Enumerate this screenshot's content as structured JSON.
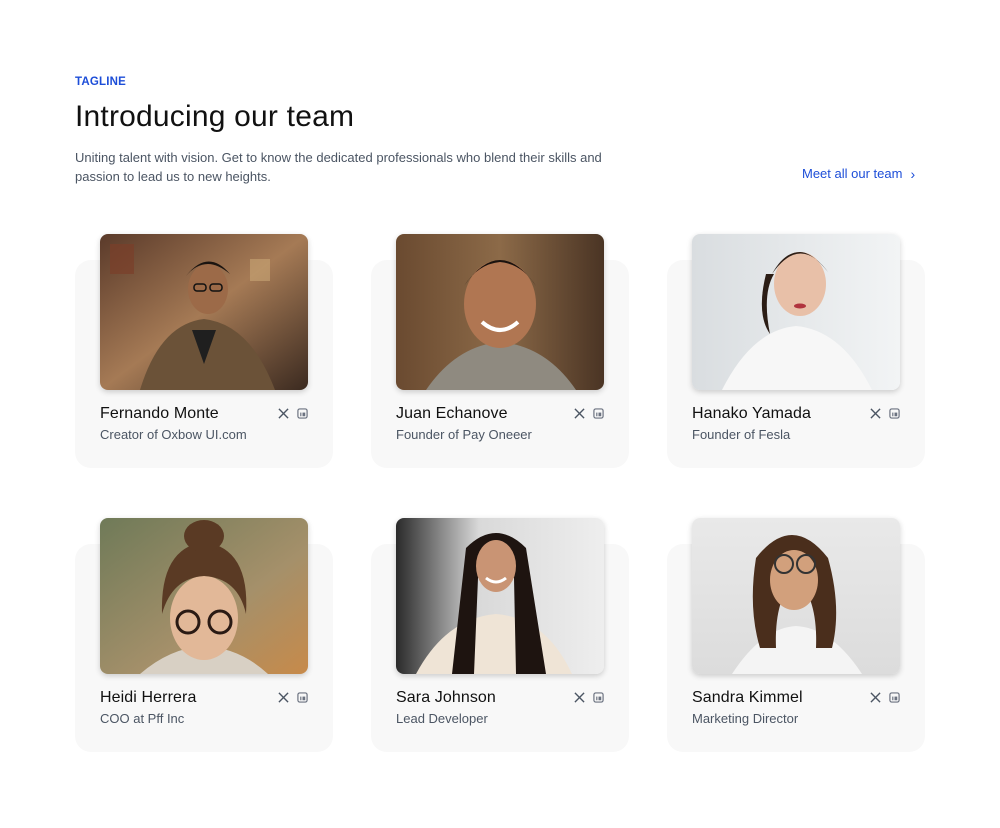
{
  "header": {
    "tagline": "TAGLINE",
    "title": "Introducing our team",
    "subtitle": "Uniting talent with vision. Get to know the dedicated professionals who blend their skills and passion to lead us to new heights.",
    "meet_link_label": "Meet all our team"
  },
  "colors": {
    "accent": "#1d4ed8",
    "card_bg": "#f8f8f8",
    "text_primary": "#111111",
    "text_secondary": "#4b5563"
  },
  "team": [
    {
      "name": "Fernando Monte",
      "role": "Creator of Oxbow UI.com",
      "icons": [
        "x-icon",
        "linkedin-icon"
      ]
    },
    {
      "name": "Juan Echanove",
      "role": "Founder of Pay Oneeer",
      "icons": [
        "x-icon",
        "linkedin-icon"
      ]
    },
    {
      "name": "Hanako Yamada",
      "role": "Founder of Fesla",
      "icons": [
        "x-icon",
        "linkedin-icon"
      ]
    },
    {
      "name": "Heidi Herrera",
      "role": "COO at Pff Inc",
      "icons": [
        "x-icon",
        "linkedin-icon"
      ]
    },
    {
      "name": "Sara Johnson",
      "role": "Lead Developer",
      "icons": [
        "x-icon",
        "linkedin-icon"
      ]
    },
    {
      "name": "Sandra Kimmel",
      "role": "Marketing Director",
      "icons": [
        "x-icon",
        "linkedin-icon"
      ]
    }
  ]
}
